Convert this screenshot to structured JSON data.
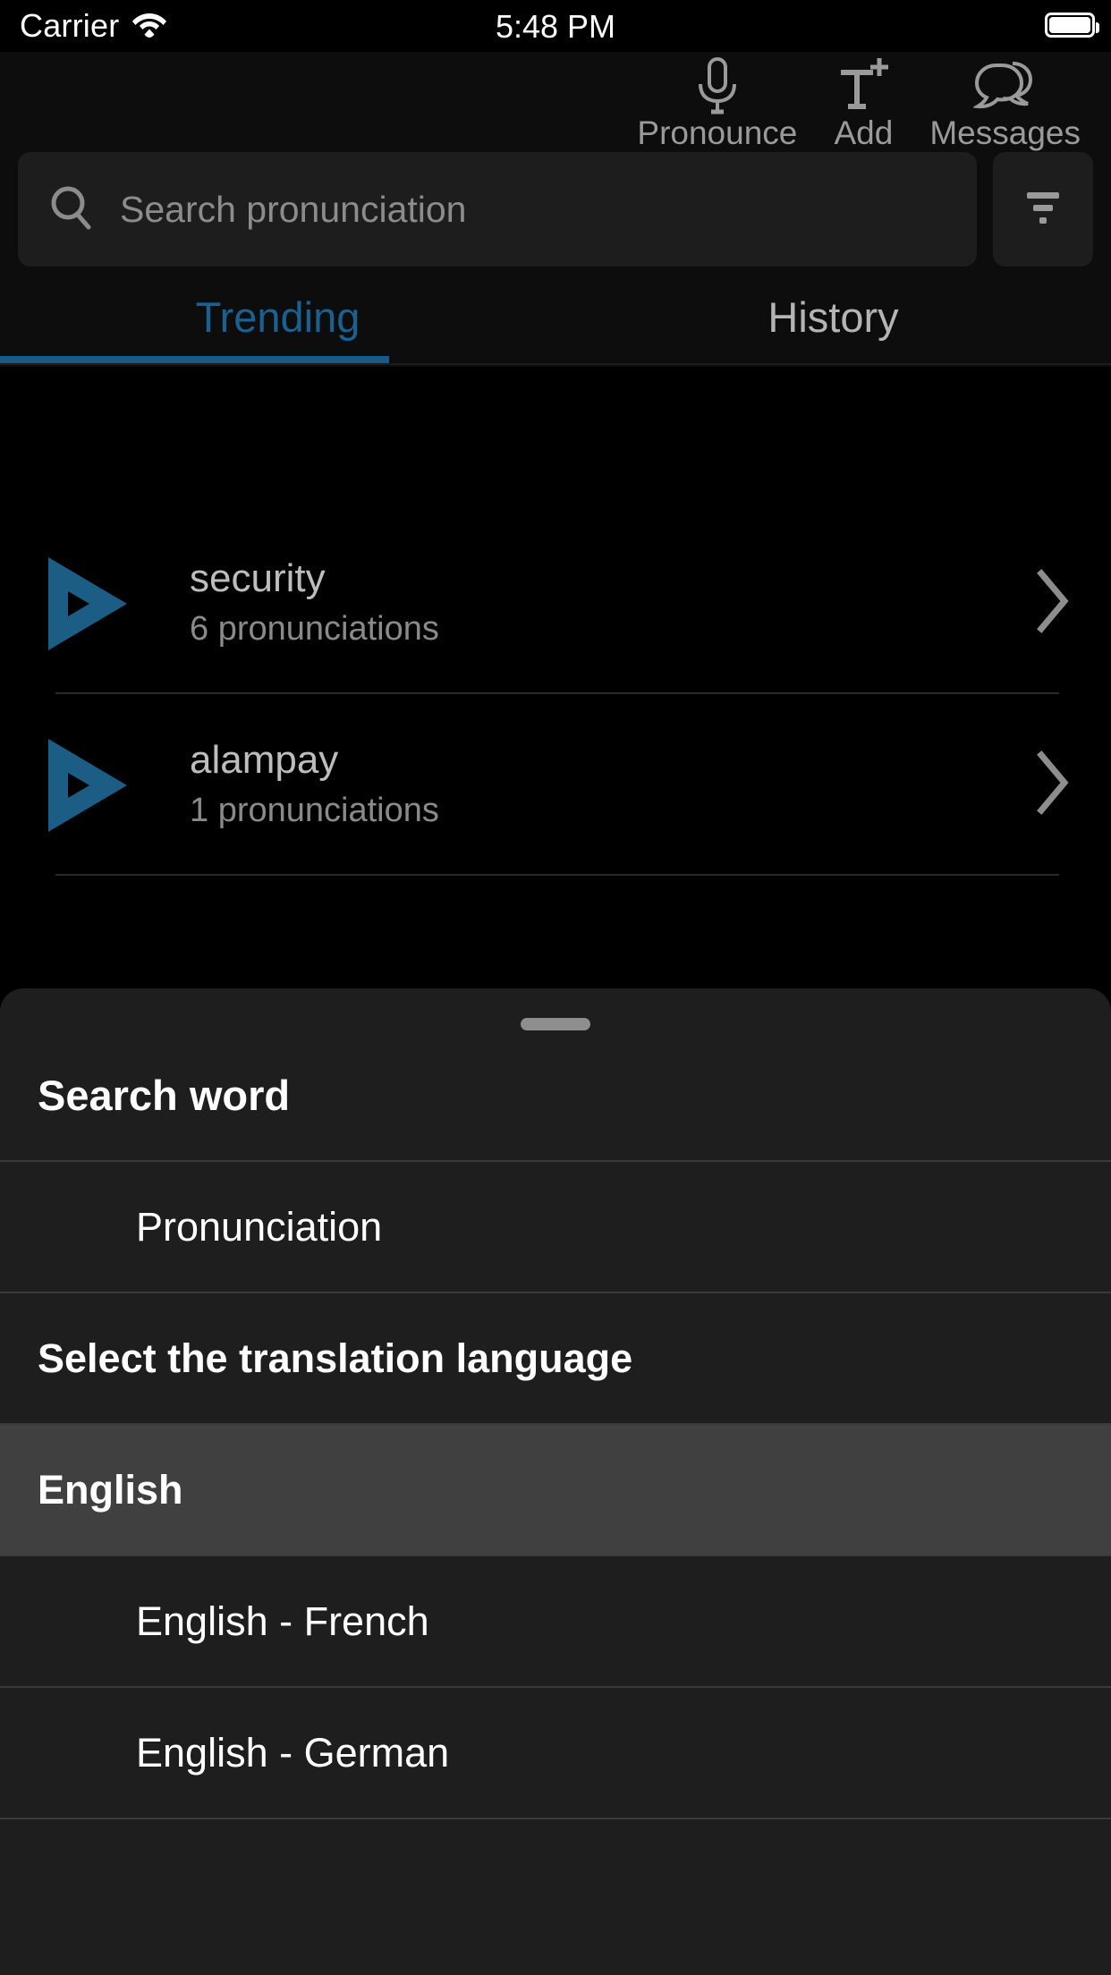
{
  "status_bar": {
    "carrier": "Carrier",
    "time": "5:48 PM",
    "wifi_icon": "wifi-icon",
    "battery_icon": "battery-full-icon"
  },
  "toolbar": {
    "items": [
      {
        "label": "Pronounce",
        "icon": "microphone-icon"
      },
      {
        "label": "Add",
        "icon": "add-text-icon"
      },
      {
        "label": "Messages",
        "icon": "speech-bubbles-icon"
      }
    ]
  },
  "search": {
    "placeholder": "Search pronunciation",
    "value": "",
    "search_icon": "search-icon",
    "filter_icon": "filter-icon"
  },
  "tabs": [
    {
      "label": "Trending",
      "active": true
    },
    {
      "label": "History",
      "active": false
    }
  ],
  "trending": {
    "rows": [
      {
        "word": "security",
        "count": "6 pronunciations",
        "play_icon": "play-triangle-icon",
        "chevron": "chevron-right-icon"
      },
      {
        "word": "alampay",
        "count": "1 pronunciations",
        "play_icon": "play-triangle-icon",
        "chevron": "chevron-right-icon"
      }
    ]
  },
  "sheet": {
    "grabber": "drag-handle",
    "title": "Search word",
    "rows": [
      {
        "label": "Pronunciation",
        "style": "indent"
      },
      {
        "label": "Select the translation language",
        "style": "bold"
      },
      {
        "label": "English",
        "style": "bold selected"
      },
      {
        "label": "English - French",
        "style": "indent"
      },
      {
        "label": "English - German",
        "style": "indent"
      }
    ]
  },
  "colors": {
    "accent_blue": "#17598a",
    "tab_active": "#1a6090",
    "sheet_bg": "#1e1e1e",
    "selected_bg": "#404040",
    "page_bg": "#000000"
  }
}
